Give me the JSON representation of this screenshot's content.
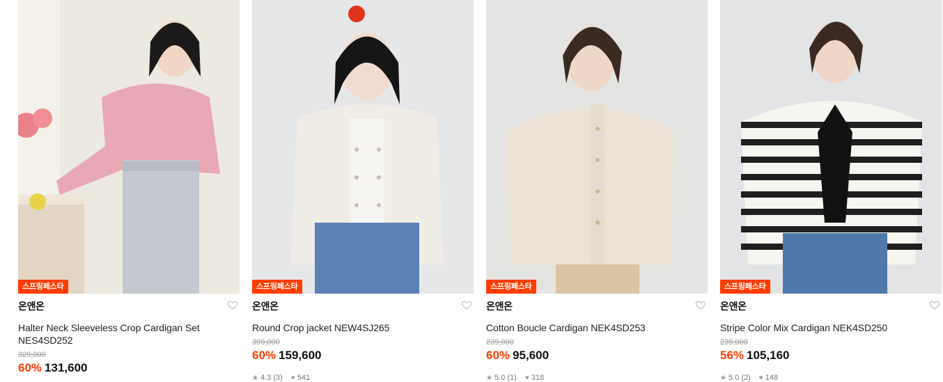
{
  "colors": {
    "accent": "#ff3d00",
    "text": "#111111",
    "muted": "#999999"
  },
  "products": [
    {
      "badge": "스프링페스타",
      "brand": "온앤온",
      "name": "Halter Neck Sleeveless Crop Cardigan Set NES4SD252",
      "original_price": "329,000",
      "discount": "60%",
      "price": "131,600",
      "rating": "",
      "reviews": "",
      "likes": ""
    },
    {
      "badge": "스프링페스타",
      "brand": "온앤온",
      "name": "Round Crop jacket NEW4SJ265",
      "original_price": "399,000",
      "discount": "60%",
      "price": "159,600",
      "rating": "4.3",
      "reviews": "(3)",
      "likes": "541"
    },
    {
      "badge": "스프링페스타",
      "brand": "온앤온",
      "name": "Cotton Boucle Cardigan NEK4SD253",
      "original_price": "239,000",
      "discount": "60%",
      "price": "95,600",
      "rating": "5.0",
      "reviews": "(1)",
      "likes": "318"
    },
    {
      "badge": "스프링페스타",
      "brand": "온앤온",
      "name": "Stripe Color Mix Cardigan NEK4SD250",
      "original_price": "239,000",
      "discount": "56%",
      "price": "105,160",
      "rating": "5.0",
      "reviews": "(2)",
      "likes": "148"
    }
  ]
}
